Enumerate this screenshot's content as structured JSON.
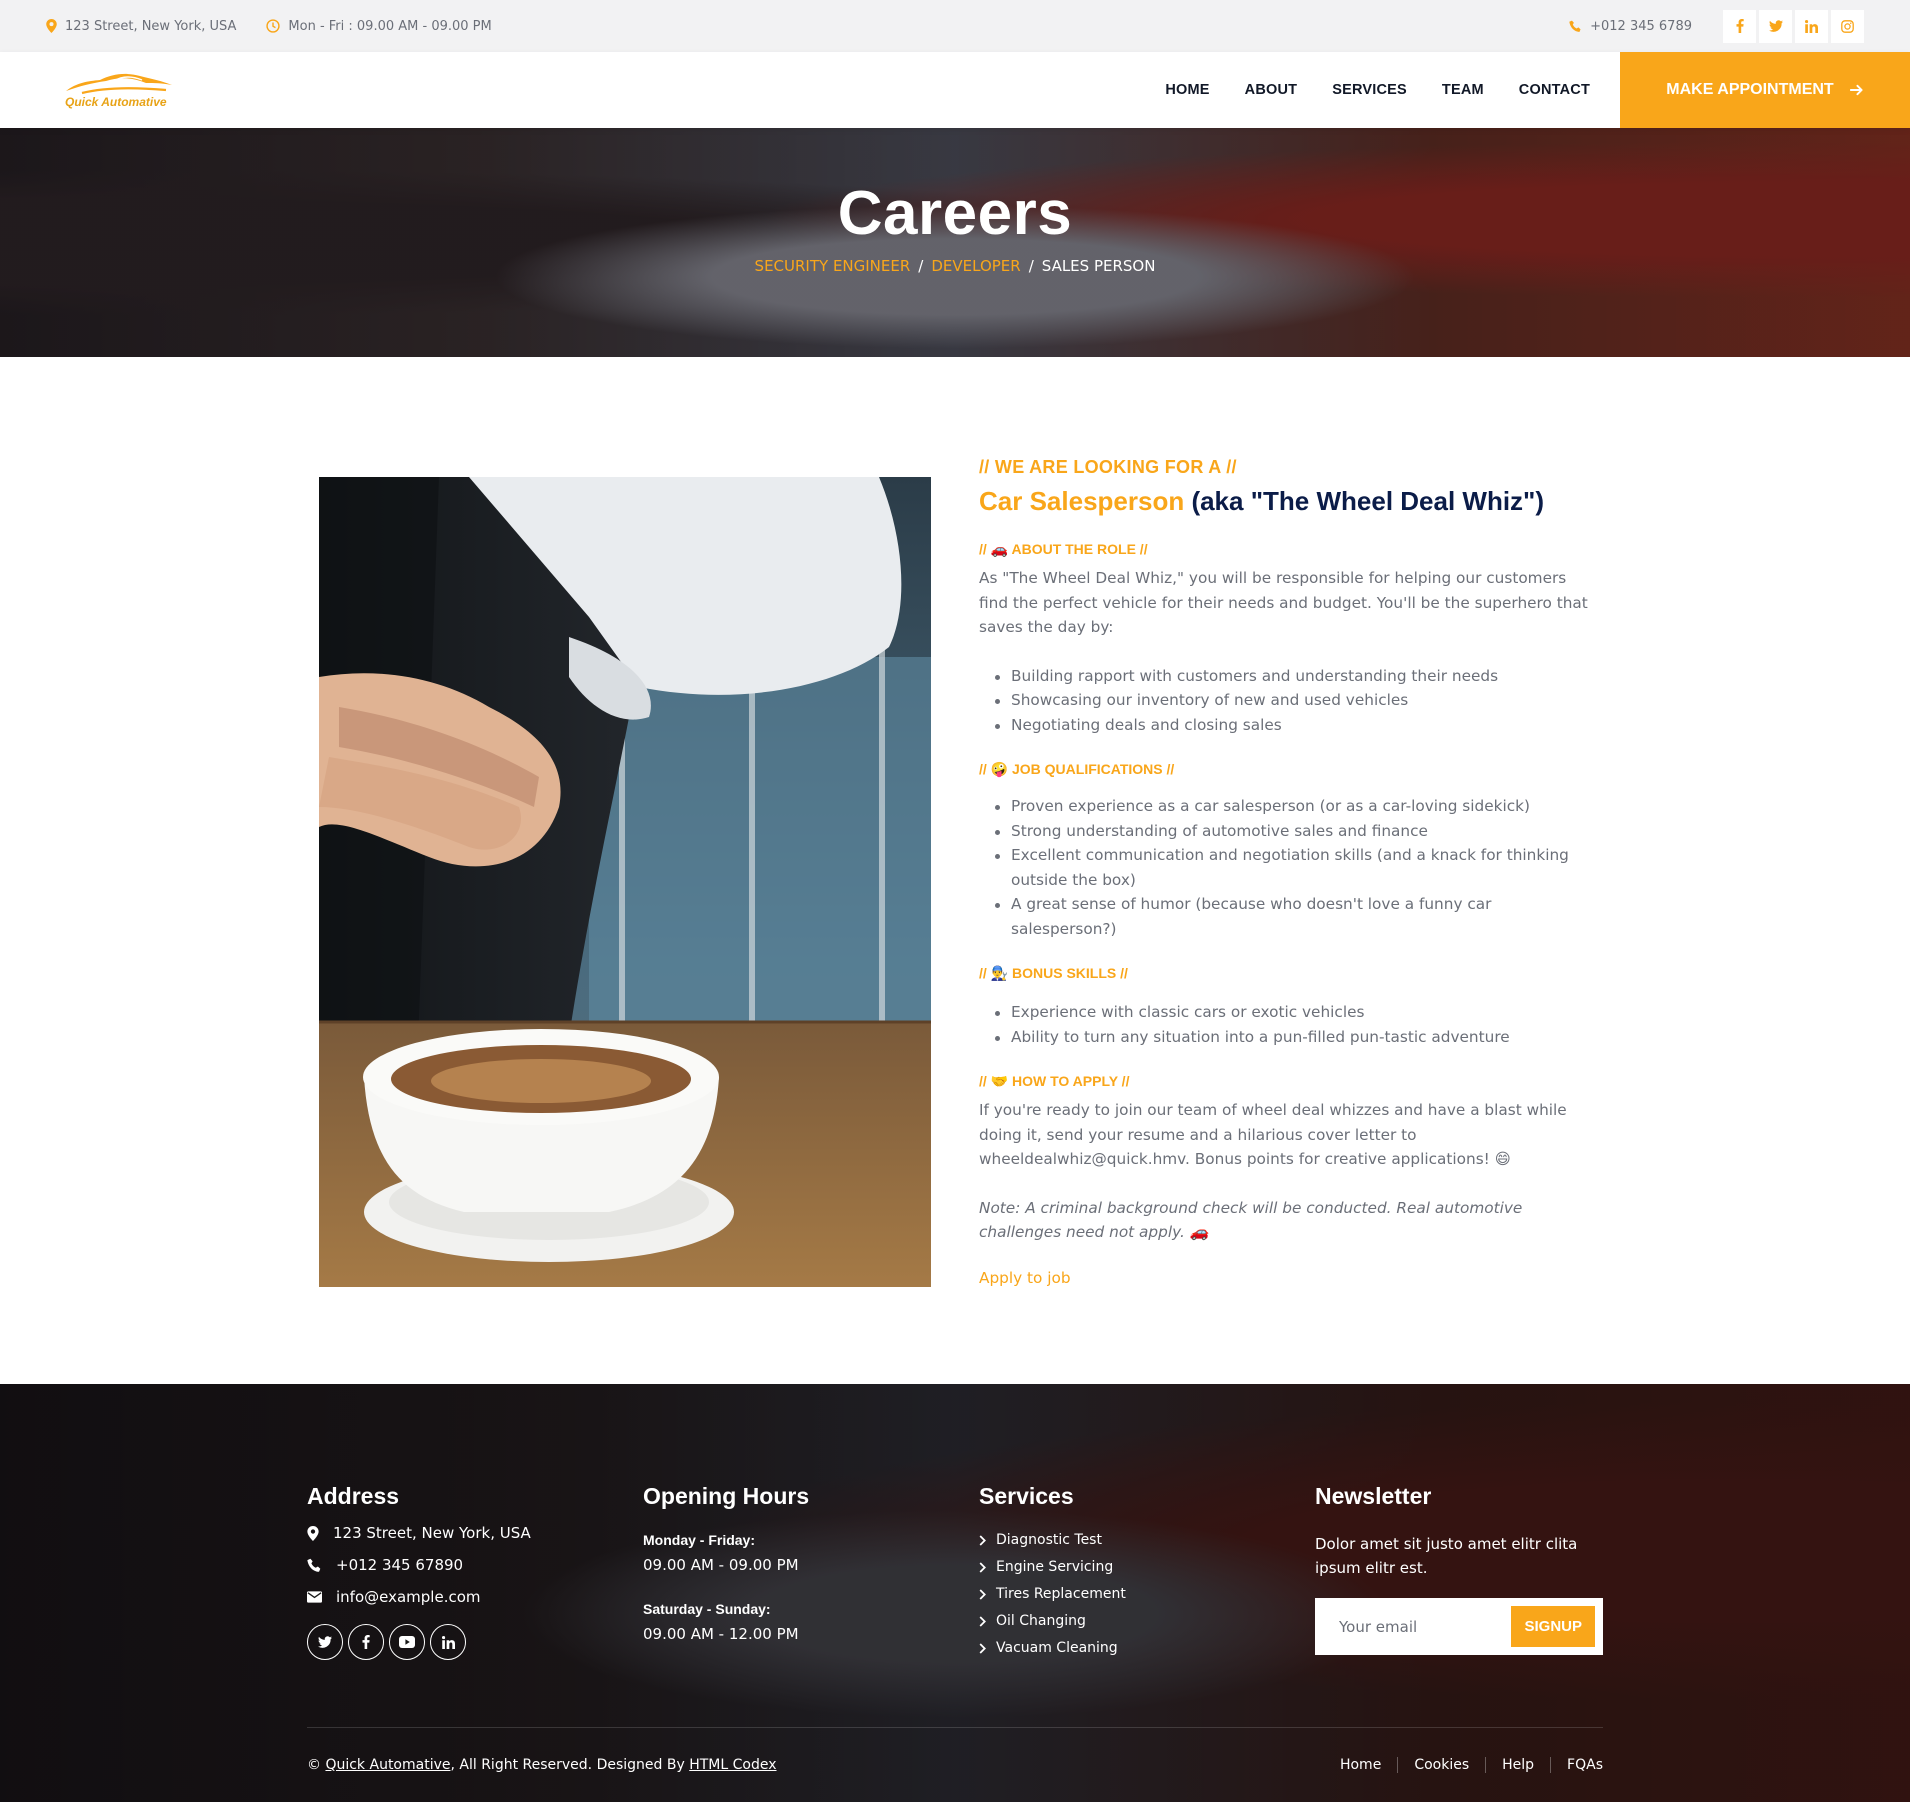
{
  "topbar": {
    "address": "123 Street, New York, USA",
    "hours": "Mon - Fri : 09.00 AM - 09.00 PM",
    "phone": "+012 345 6789"
  },
  "brand": {
    "name": "Quick Automative"
  },
  "nav": {
    "links": [
      "HOME",
      "ABOUT",
      "SERVICES",
      "TEAM",
      "CONTACT"
    ],
    "cta": "MAKE APPOINTMENT"
  },
  "hero": {
    "title": "Careers",
    "crumbs": [
      "SECURITY ENGINEER",
      "DEVELOPER",
      "SALES PERSON"
    ]
  },
  "job": {
    "kicker": "// WE ARE LOOKING FOR A //",
    "title_accent": "Car Salesperson",
    "title_rest": " (aka \"The Wheel Deal Whiz\")",
    "about_head": "// 🚗 ABOUT THE ROLE //",
    "about_text": "As \"The Wheel Deal Whiz,\" you will be responsible for helping our customers find the perfect vehicle for their needs and budget. You'll be the superhero that saves the day by:",
    "about_items": [
      "Building rapport with customers and understanding their needs",
      "Showcasing our inventory of new and used vehicles",
      "Negotiating deals and closing sales"
    ],
    "qual_head": "// 🤪 JOB QUALIFICATIONS //",
    "qual_items": [
      "Proven experience as a car salesperson (or as a car-loving sidekick)",
      "Strong understanding of automotive sales and finance",
      "Excellent communication and negotiation skills (and a knack for thinking outside the box)",
      "A great sense of humor (because who doesn't love a funny car salesperson?)"
    ],
    "bonus_head": "// 👨‍🔧 BONUS SKILLS //",
    "bonus_items": [
      "Experience with classic cars or exotic vehicles",
      "Ability to turn any situation into a pun-filled pun-tastic adventure"
    ],
    "apply_head": "// 🤝 HOW TO APPLY //",
    "apply_text": "If you're ready to join our team of wheel deal whizzes and have a blast while doing it, send your resume and a hilarious cover letter to wheeldealwhiz@quick.hmv. Bonus points for creative applications! 😄",
    "note": "Note: A criminal background check will be conducted. Real automotive challenges need not apply. 🚗",
    "apply_link": "Apply to job"
  },
  "footer": {
    "address": {
      "title": "Address",
      "street": "123 Street, New York, USA",
      "phone": "+012 345 67890",
      "email": "info@example.com"
    },
    "hours": {
      "title": "Opening Hours",
      "weekday_label": "Monday - Friday:",
      "weekday_value": "09.00 AM - 09.00 PM",
      "weekend_label": "Saturday - Sunday:",
      "weekend_value": "09.00 AM - 12.00 PM"
    },
    "services": {
      "title": "Services",
      "items": [
        "Diagnostic Test",
        "Engine Servicing",
        "Tires Replacement",
        "Oil Changing",
        "Vacuam Cleaning"
      ]
    },
    "newsletter": {
      "title": "Newsletter",
      "text": "Dolor amet sit justo amet elitr clita ipsum elitr est.",
      "placeholder": "Your email",
      "button": "SIGNUP"
    },
    "copyright_prefix": "© ",
    "copyright_brand": "Quick Automative",
    "copyright_mid": ", All Right Reserved. Designed By ",
    "copyright_designer": "HTML Codex",
    "links": [
      "Home",
      "Cookies",
      "Help",
      "FQAs"
    ]
  },
  "colors": {
    "accent": "#f9a61a",
    "navy": "#0b1c48",
    "text": "#6b6f78"
  }
}
